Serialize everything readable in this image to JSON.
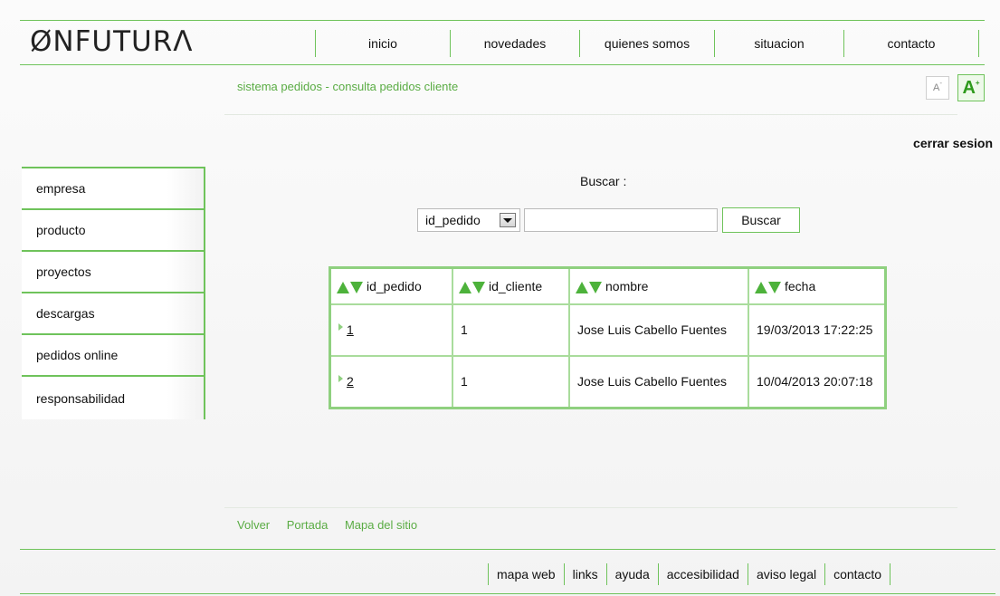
{
  "logo": "ØNFUTURΛ",
  "topnav": [
    "inicio",
    "novedades",
    "quienes somos",
    "situacion",
    "contacto"
  ],
  "subtitle": "sistema pedidos - consulta pedidos cliente",
  "font_small_label": "A",
  "font_large_label": "A",
  "cerrar_sesion": "cerrar sesion",
  "sidebar": [
    "empresa",
    "producto",
    "proyectos",
    "descargas",
    "pedidos online",
    "responsabilidad"
  ],
  "search": {
    "label": "Buscar :",
    "select_value": "id_pedido",
    "input_value": "",
    "button": "Buscar"
  },
  "table": {
    "headers": [
      "id_pedido",
      "id_cliente",
      "nombre",
      "fecha"
    ],
    "rows": [
      {
        "id_pedido": "1",
        "id_cliente": "1",
        "nombre": "Jose Luis Cabello Fuentes",
        "fecha": "19/03/2013 17:22:25"
      },
      {
        "id_pedido": "2",
        "id_cliente": "1",
        "nombre": "Jose Luis Cabello Fuentes",
        "fecha": "10/04/2013 20:07:18"
      }
    ]
  },
  "bottom_links": [
    "Volver",
    "Portada",
    "Mapa del sitio"
  ],
  "footer_nav": [
    "mapa web",
    "links",
    "ayuda",
    "accesibilidad",
    "aviso legal",
    "contacto"
  ],
  "colors": {
    "accent": "#6fc35b",
    "subtitle": "#5aac44",
    "arrow": "#4db23b"
  }
}
